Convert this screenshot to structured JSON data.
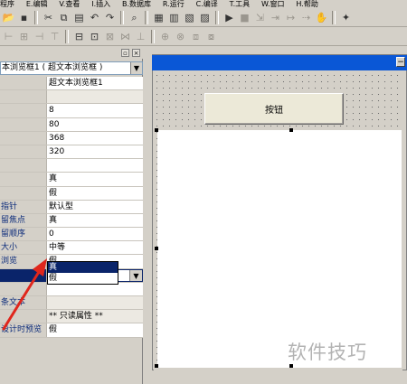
{
  "menu": [
    "程序",
    "E.编辑",
    "V.查看",
    "I.插入",
    "B.数据库",
    "R.运行",
    "C.编译",
    "T.工具",
    "W.窗口",
    "H.帮助"
  ],
  "property_panel": {
    "object_select": "本浏览框1 ( 超文本浏览框 )",
    "rows": [
      {
        "key": "",
        "value": "超文本浏览框1"
      },
      {
        "key": "",
        "value": ""
      },
      {
        "key": "",
        "value": "8"
      },
      {
        "key": "",
        "value": "80"
      },
      {
        "key": "",
        "value": "368"
      },
      {
        "key": "",
        "value": "320"
      },
      {
        "key": "",
        "value": ""
      },
      {
        "key": "",
        "value": "真"
      },
      {
        "key": "",
        "value": "假"
      },
      {
        "key": "指针",
        "value": "默认型"
      },
      {
        "key": "留焦点",
        "value": "真"
      },
      {
        "key": "留顺序",
        "value": "0"
      },
      {
        "key": "大小",
        "value": "中等"
      },
      {
        "key": "浏览",
        "value": "假"
      },
      {
        "key": "",
        "value": "假"
      },
      {
        "key": "",
        "value": ""
      },
      {
        "key": "条文本",
        "value": ""
      },
      {
        "key": "",
        "value": "** 只读属性 **"
      },
      {
        "key": "设计时预览",
        "value": "假"
      }
    ],
    "dropdown_options": [
      "真",
      "假"
    ],
    "selected_option": "真"
  },
  "designer": {
    "button_label": "按钮"
  },
  "watermark": "软件技巧",
  "colors": {
    "titlebar": "#0a57d6",
    "selection": "#0a246a",
    "arrow": "#e0261c"
  }
}
